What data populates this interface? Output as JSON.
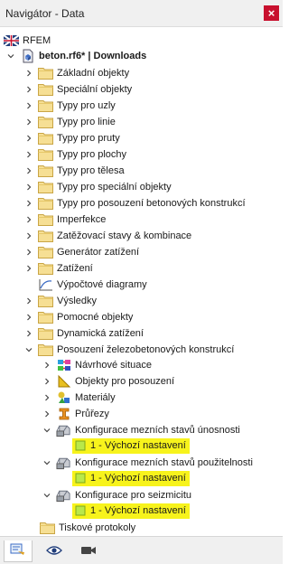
{
  "window": {
    "title": "Navigátor - Data",
    "close_glyph": "×"
  },
  "tree": {
    "root": "RFEM",
    "file": "beton.rf6* | Downloads",
    "items": [
      "Základní objekty",
      "Speciální objekty",
      "Typy pro uzly",
      "Typy pro linie",
      "Typy pro pruty",
      "Typy pro plochy",
      "Typy pro tělesa",
      "Typy pro speciální objekty",
      "Typy pro posouzení betonových konstrukcí",
      "Imperfekce",
      "Zatěžovací stavy & kombinace",
      "Generátor zatížení",
      "Zatížení",
      "Výpočtové diagramy",
      "Výsledky",
      "Pomocné objekty",
      "Dynamická zatížení",
      "Posouzení železobetonových konstrukcí"
    ],
    "design_children": [
      "Návrhové situace",
      "Objekty pro posouzení",
      "Materiály",
      "Průřezy",
      "Konfigurace mezních stavů únosnosti",
      "1 - Výchozí nastavení",
      "Konfigurace mezních stavů použitelnosti",
      "1 - Výchozí nastavení",
      "Konfigurace pro seizmicitu",
      "1 - Výchozí nastavení"
    ],
    "last_item": "Tiskové protokoly"
  },
  "colors": {
    "highlight": "#f7f31c",
    "folder": "#f3d98c",
    "close": "#c8102e"
  },
  "bottom_tabs": [
    "data-tab-icon",
    "view-tab-icon",
    "camera-tab-icon"
  ]
}
